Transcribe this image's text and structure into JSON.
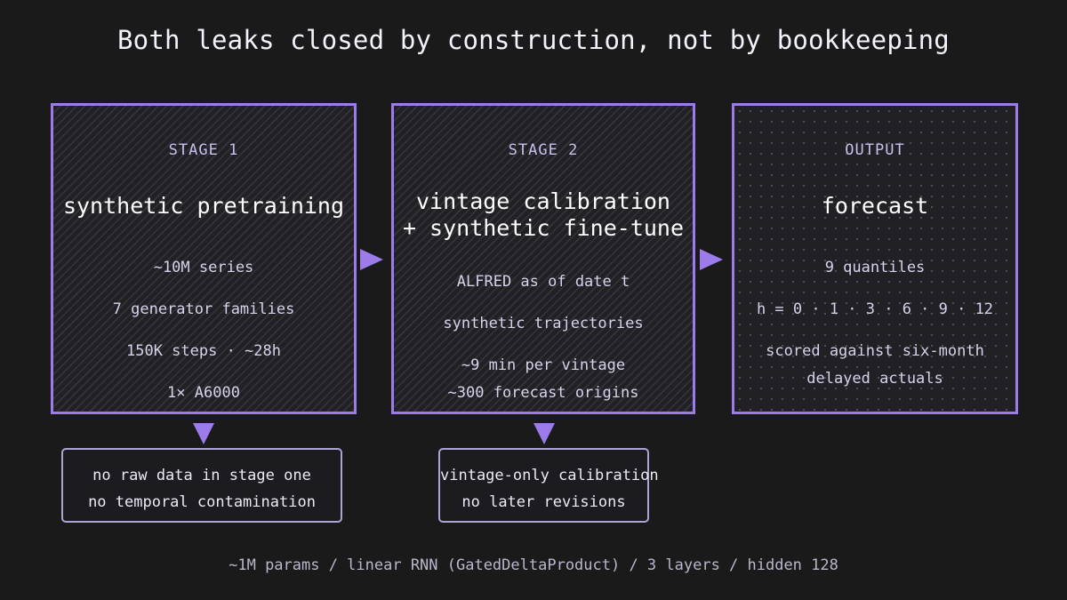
{
  "title": "Both leaks closed by construction, not by bookkeeping",
  "accent_color": "#9c7cea",
  "stages": [
    {
      "label": "STAGE 1",
      "heading": [
        "synthetic pretraining"
      ],
      "lines": [
        "~10M series",
        "7 generator families",
        "150K steps · ~28h",
        "1× A6000"
      ]
    },
    {
      "label": "STAGE 2",
      "heading": [
        "vintage calibration",
        "+ synthetic fine-tune"
      ],
      "lines": [
        "ALFRED as of date t",
        "synthetic trajectories",
        "~9 min per vintage",
        "~300 forecast origins"
      ]
    },
    {
      "label": "OUTPUT",
      "heading": [
        "forecast"
      ],
      "lines": [
        "9 quantiles",
        "h = 0 · 1 · 3 · 6 · 9 · 12",
        "scored against six-month",
        "delayed actuals"
      ]
    }
  ],
  "notes": [
    {
      "lines": [
        "no raw data in stage one",
        "no temporal contamination"
      ]
    },
    {
      "lines": [
        "vintage-only calibration",
        "no later revisions"
      ]
    }
  ],
  "footer": "~1M params / linear RNN (GatedDeltaProduct) / 3 layers / hidden 128"
}
